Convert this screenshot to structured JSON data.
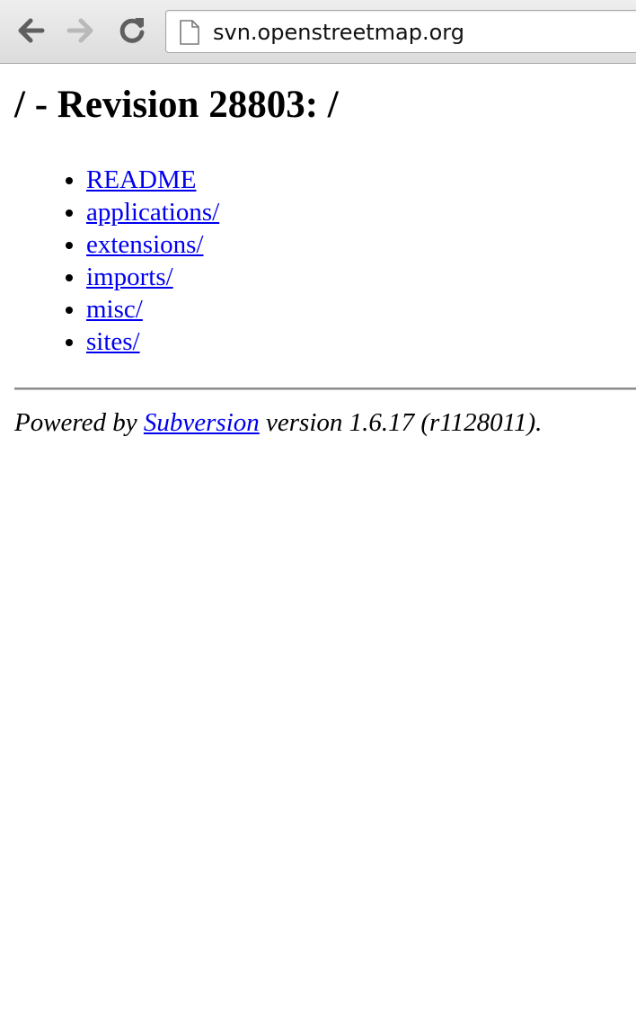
{
  "browser": {
    "url": "svn.openstreetmap.org",
    "icons": {
      "back": "arrow-left-icon",
      "forward": "arrow-right-icon",
      "reload": "reload-icon",
      "page": "document-icon"
    }
  },
  "page": {
    "title": "/ - Revision 28803: /",
    "entries": [
      {
        "label": "README"
      },
      {
        "label": "applications/"
      },
      {
        "label": "extensions/"
      },
      {
        "label": "imports/"
      },
      {
        "label": "misc/"
      },
      {
        "label": "sites/"
      }
    ],
    "footer": {
      "prefix": "Powered by ",
      "link_label": "Subversion",
      "suffix": " version 1.6.17 (r1128011)."
    },
    "colors": {
      "link": "#0000ee"
    }
  }
}
